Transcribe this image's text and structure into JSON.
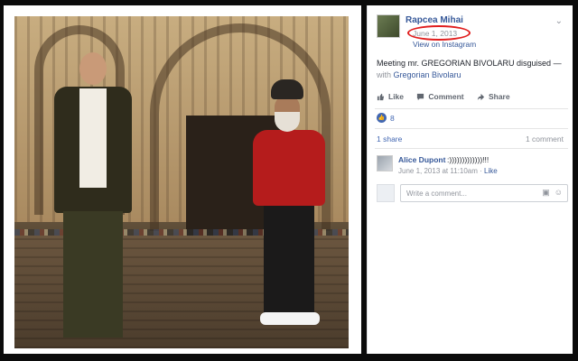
{
  "post": {
    "author": "Rapcea Mihai",
    "date": "June 1, 2013",
    "view_on": "View on Instagram",
    "message": "Meeting mr. GREGORIAN BIVOLARU disguised —",
    "with_prefix": "with",
    "tagged": "Gregorian Bivolaru"
  },
  "actions": {
    "like": "Like",
    "comment": "Comment",
    "share": "Share"
  },
  "stats": {
    "likes": "8",
    "shares": "1 share",
    "comments": "1 comment"
  },
  "comment": {
    "author": "Alice Dupont",
    "text": ":)))))))))))))!!!",
    "timestamp": "June 1, 2013 at 11:10am",
    "like_link": "Like"
  },
  "composer": {
    "placeholder": "Write a comment..."
  },
  "colors": {
    "link": "#365899",
    "highlight": "#e01e1e",
    "like_blue": "#4267b2"
  },
  "icons": [
    "chevron-down-icon",
    "like-icon",
    "comment-icon",
    "share-icon",
    "camera-icon",
    "emoji-icon"
  ]
}
